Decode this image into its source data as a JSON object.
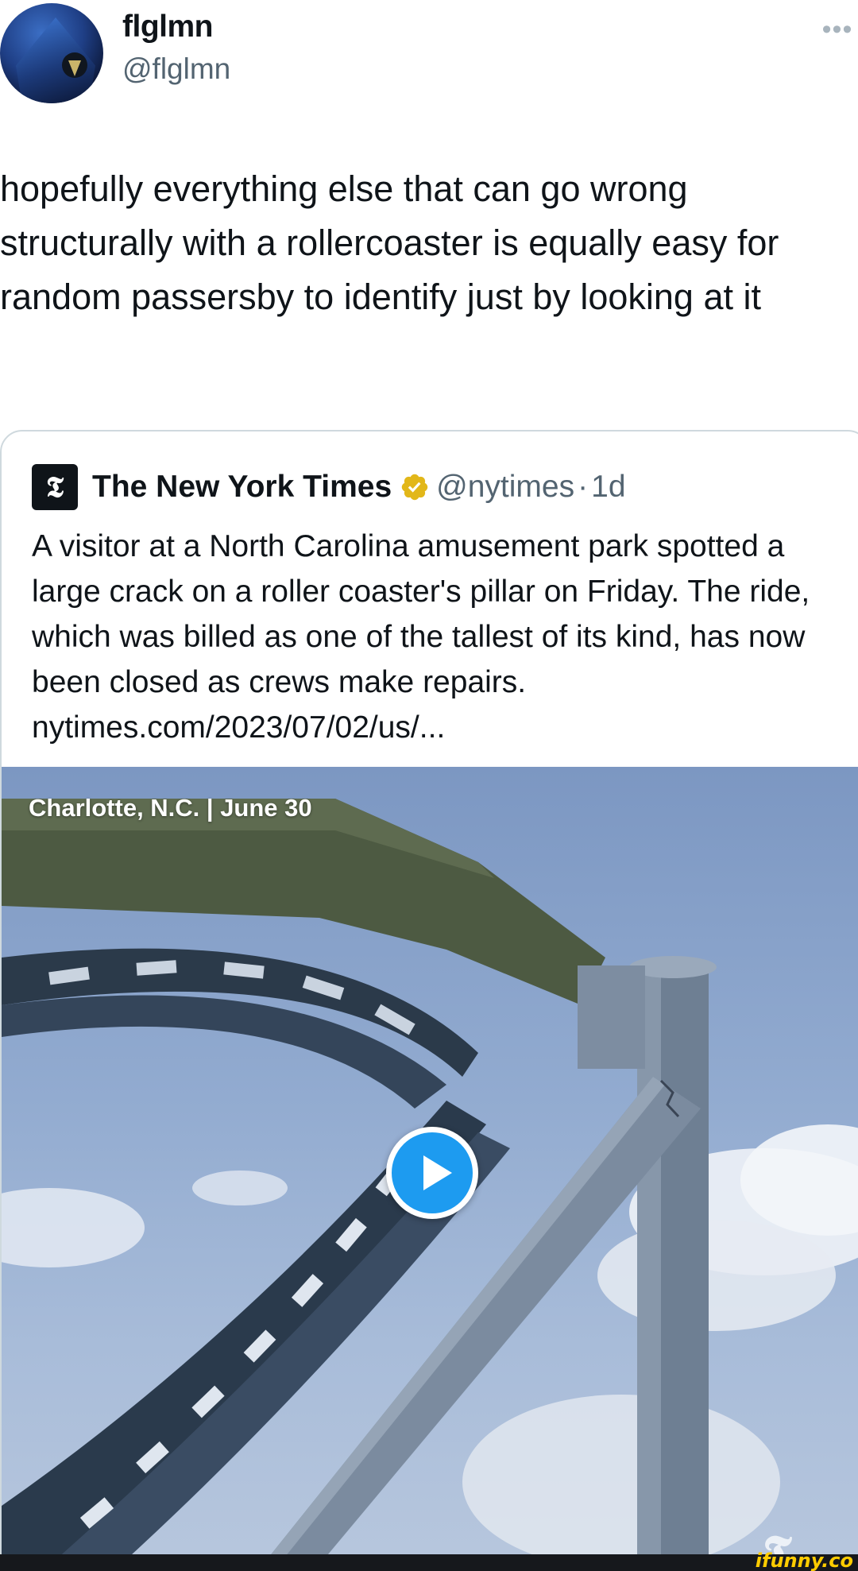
{
  "author": {
    "display_name": "flglmn",
    "handle": "@flglmn",
    "avatar_icon": "hooded-crow-avatar"
  },
  "tweet": {
    "text": "hopefully everything else that can go wrong structurally with a rollercoaster is equally easy for random passersby to identify just by looking at it"
  },
  "quoted_tweet": {
    "logo_glyph": "𝕿",
    "display_name": "The New York Times",
    "verified_icon": "gold-verified-badge",
    "handle": "@nytimes",
    "separator": "·",
    "time": "1d",
    "text": "A visitor at a North Carolina amusement park spotted a large crack on a roller coaster's pillar on Friday. The ride, which was billed as one of the tallest of its kind, has now been closed as crews make repairs. nytimes.com/2023/07/02/us/...",
    "video": {
      "caption": "Charlotte, N.C.  |  June 30",
      "watermark": "𝕿",
      "play_icon": "play-icon"
    }
  },
  "footer": {
    "logo_text": "ifunny.co"
  },
  "colors": {
    "accent": "#1d9bf0",
    "verified": "#e2b719",
    "secondary_text": "#536471",
    "border": "#cfd9de"
  }
}
